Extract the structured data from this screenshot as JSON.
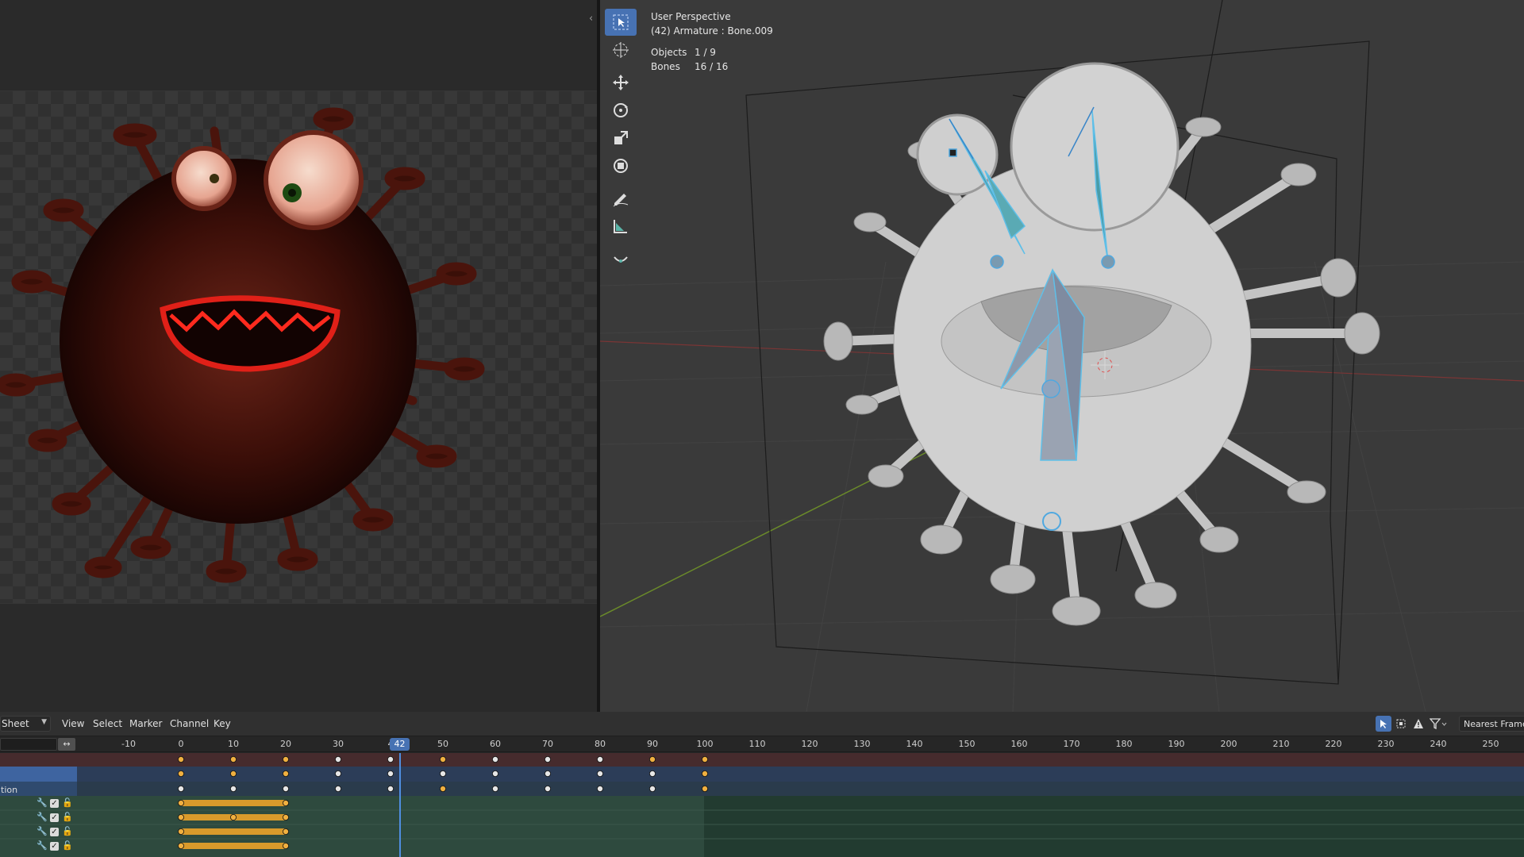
{
  "viewport": {
    "title": "User Perspective",
    "subtitle": "(42) Armature : Bone.009",
    "stats": [
      {
        "label": "Objects",
        "value": "1 / 9"
      },
      {
        "label": "Bones",
        "value": "16 / 16"
      }
    ],
    "tools": [
      "select-box-icon",
      "cursor-icon",
      "move-icon",
      "rotate-icon",
      "scale-icon",
      "transform-icon",
      "annotate-icon",
      "measure-icon",
      "roll-icon"
    ]
  },
  "dopesheet": {
    "mode_label": "Sheet",
    "menus": [
      "View",
      "Select",
      "Marker",
      "Channel",
      "Key"
    ],
    "snap_label": "Nearest Frame",
    "current_frame": "42",
    "sync_icon": "↔",
    "ruler_labels": [
      "-10",
      "0",
      "10",
      "20",
      "30",
      "4",
      "50",
      "60",
      "70",
      "80",
      "90",
      "100",
      "110",
      "120",
      "130",
      "140",
      "150",
      "160",
      "170",
      "180",
      "190",
      "200",
      "210",
      "220",
      "230",
      "240",
      "250"
    ],
    "channel_text": "tion",
    "channel_icons": {
      "wrench": "🔧",
      "check": "✓",
      "lock": "🔓"
    },
    "colors": {
      "selected": "#4772b3",
      "keyframe": "#f0b040",
      "hold": "#d99a2b"
    }
  }
}
